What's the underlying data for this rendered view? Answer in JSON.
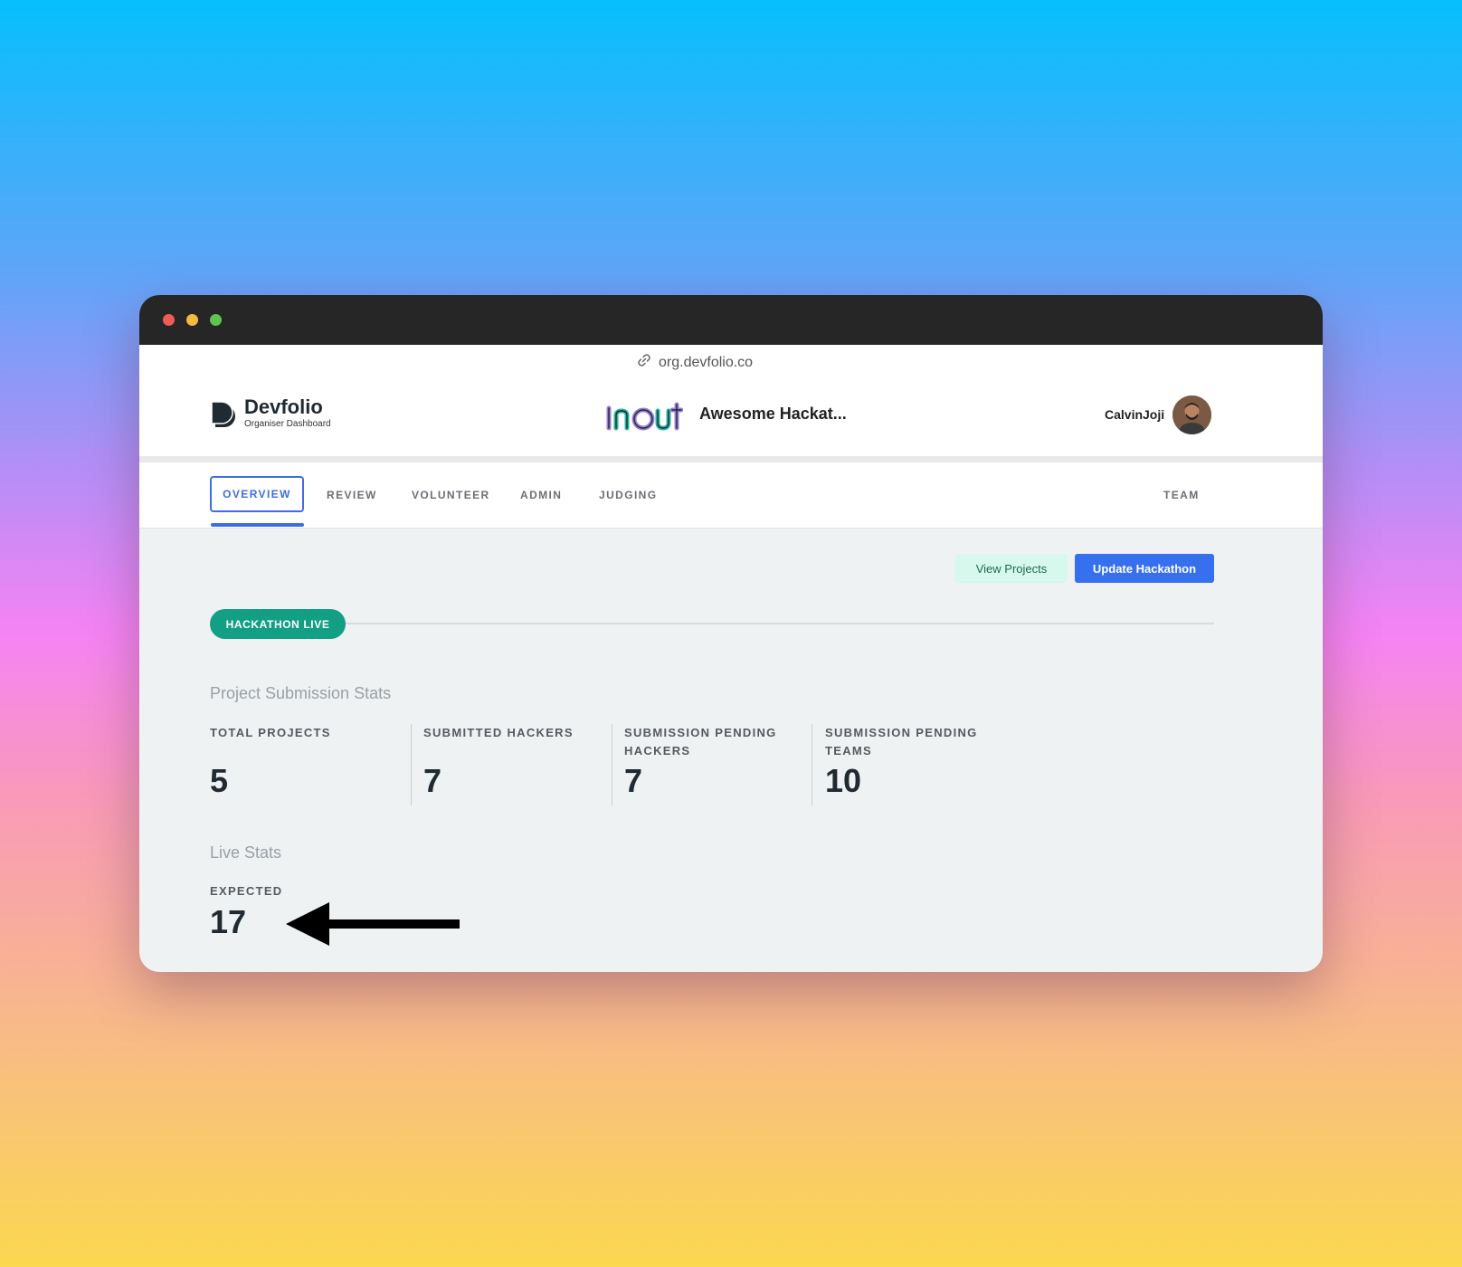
{
  "browser": {
    "url": "org.devfolio.co",
    "icons": [
      "link-icon"
    ]
  },
  "header": {
    "brand": "Devfolio",
    "brand_subtitle": "Organiser Dashboard",
    "event_name": "Awesome Hackat...",
    "username": "CalvinJoji"
  },
  "nav": {
    "tabs": [
      {
        "label": "OVERVIEW",
        "active": true
      },
      {
        "label": "REVIEW",
        "active": false
      },
      {
        "label": "VOLUNTEER",
        "active": false
      },
      {
        "label": "ADMIN",
        "active": false
      },
      {
        "label": "JUDGING",
        "active": false
      }
    ],
    "right_tab": "TEAM"
  },
  "actions": {
    "view_projects": "View Projects",
    "update_hackathon": "Update Hackathon"
  },
  "status_badge": "HACKATHON LIVE",
  "project_stats": {
    "title": "Project Submission Stats",
    "items": [
      {
        "label": "TOTAL PROJECTS",
        "value": "5"
      },
      {
        "label": "SUBMITTED HACKERS",
        "value": "7"
      },
      {
        "label": "SUBMISSION PENDING HACKERS",
        "value": "7"
      },
      {
        "label": "SUBMISSION PENDING TEAMS",
        "value": "10"
      }
    ]
  },
  "live_stats": {
    "title": "Live Stats",
    "expected_label": "EXPECTED",
    "expected_value": "17"
  },
  "colors": {
    "accent": "#3d6ddf",
    "primary_button": "#3770ef",
    "live_badge": "#129f83"
  }
}
